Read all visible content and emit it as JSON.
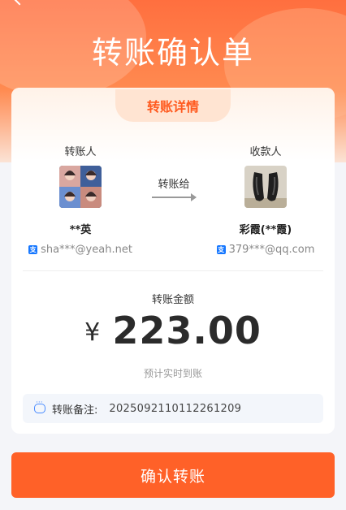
{
  "page": {
    "title": "转账确认单"
  },
  "card": {
    "tab_label": "转账详情",
    "sender": {
      "label": "转账人",
      "name": "**英",
      "account": "sha***@yeah.net"
    },
    "arrow_label": "转账给",
    "receiver": {
      "label": "收款人",
      "name": "彩霞(**霞)",
      "account": "379***@qq.com"
    },
    "amount": {
      "label": "转账金额",
      "currency": "¥",
      "value": "223.00",
      "sub": "预计实时到账"
    },
    "memo": {
      "label": "转账备注:",
      "value": "2025092110112261209"
    }
  },
  "footer": {
    "confirm_label": "确认转账"
  },
  "colors": {
    "accent": "#ff6128",
    "alipay_blue": "#1677ff"
  },
  "icons": {
    "back": "back-icon",
    "account": "alipay-icon",
    "memo": "chat-icon"
  }
}
